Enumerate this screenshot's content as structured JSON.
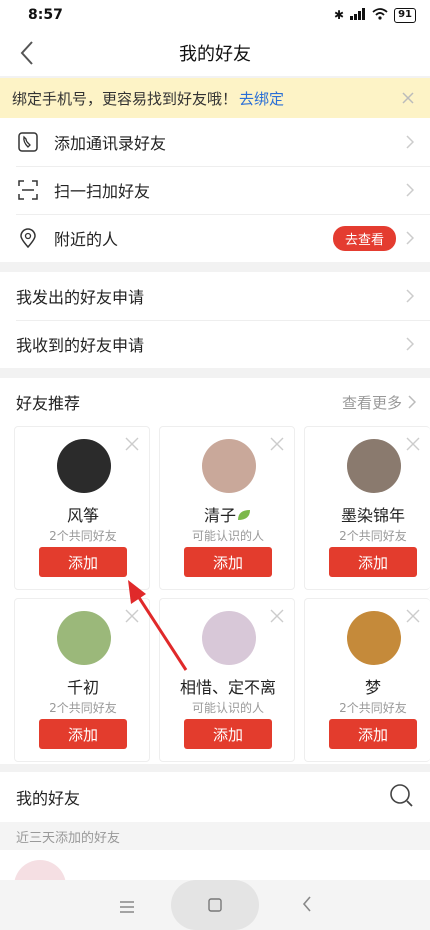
{
  "status_bar": {
    "time": "8:57",
    "battery": "91"
  },
  "nav": {
    "title": "我的好友"
  },
  "banner": {
    "text": "绑定手机号，更容易找到好友哦！",
    "link": "去绑定"
  },
  "menu": [
    {
      "label": "添加通讯录好友",
      "icon": "phone-contacts-icon"
    },
    {
      "label": "扫一扫加好友",
      "icon": "scan-icon"
    },
    {
      "label": "附近的人",
      "icon": "location-pin-icon",
      "badge": "去查看"
    }
  ],
  "requests": [
    {
      "label": "我发出的好友申请"
    },
    {
      "label": "我收到的好友申请"
    }
  ],
  "recommend": {
    "title": "好友推荐",
    "more": "查看更多",
    "add_label": "添加",
    "cards": [
      {
        "name": "风筝",
        "sub": "2个共同好友",
        "color": "#2b2b2b"
      },
      {
        "name": "清子",
        "sub": "可能认识的人",
        "color": "#c9a89a"
      },
      {
        "name": "墨染锦年",
        "sub": "2个共同好友",
        "color": "#8a7a6e"
      },
      {
        "name": "千初",
        "sub": "2个共同好友",
        "color": "#9bb87a"
      },
      {
        "name": "相惜、定不离",
        "sub": "可能认识的人",
        "color": "#d8c8d8"
      },
      {
        "name": "梦",
        "sub": "2个共同好友",
        "color": "#c58a3a"
      }
    ]
  },
  "friends": {
    "title": "我的好友",
    "recent": "近三天添加的好友"
  },
  "colors": {
    "accent": "#e33c2d",
    "banner_bg": "#fdf3c6",
    "link": "#2a6fd6"
  }
}
